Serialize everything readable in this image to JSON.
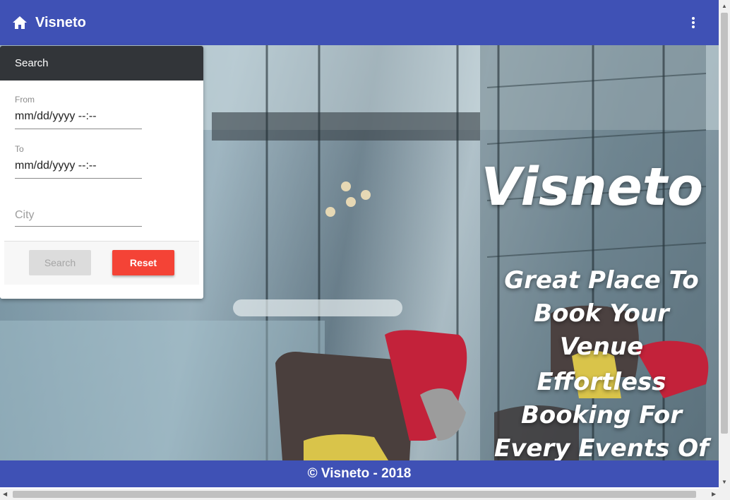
{
  "appbar": {
    "title": "Visneto",
    "home_icon": "home-icon",
    "more_icon": "more-vert-icon",
    "color": "#3f51b5"
  },
  "search_panel": {
    "header": "Search",
    "from": {
      "label": "From",
      "value": "mm/dd/yyyy --:--"
    },
    "to": {
      "label": "To",
      "value": "mm/dd/yyyy --:--"
    },
    "city": {
      "placeholder": "City"
    },
    "search_button": "Search",
    "reset_button": "Reset"
  },
  "hero": {
    "brand": "Visneto",
    "tagline1": "Great Place To Book Your Venue",
    "tagline2": "Effortless Booking For Every Events Of"
  },
  "footer": {
    "text": "© Visneto - 2018"
  }
}
